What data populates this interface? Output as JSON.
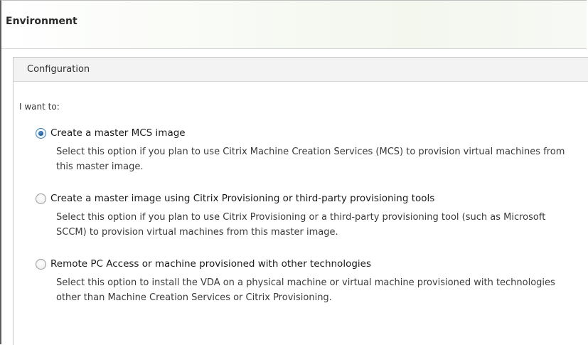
{
  "window": {
    "title": "Environment"
  },
  "panel": {
    "title": "Configuration"
  },
  "prompt": "I want to:",
  "options": [
    {
      "label": "Create a master MCS image",
      "description": "Select this option if you plan to use Citrix Machine Creation Services (MCS) to provision virtual machines from this master image.",
      "selected": true
    },
    {
      "label": "Create a master image using Citrix Provisioning or third-party provisioning tools",
      "description": "Select this option if you plan to use Citrix Provisioning or a third-party provisioning tool (such as Microsoft SCCM) to provision virtual machines from this master image.",
      "selected": false
    },
    {
      "label": "Remote PC Access or machine provisioned with other technologies",
      "description": "Select this option to install the VDA on a physical machine or virtual machine provisioned with technologies other than Machine Creation Services or Citrix Provisioning.",
      "selected": false
    }
  ],
  "colors": {
    "radio_selected": "#1f5f9e",
    "header_bg": "#f3f7ee",
    "panel_header_bg": "#f3f3f3"
  }
}
